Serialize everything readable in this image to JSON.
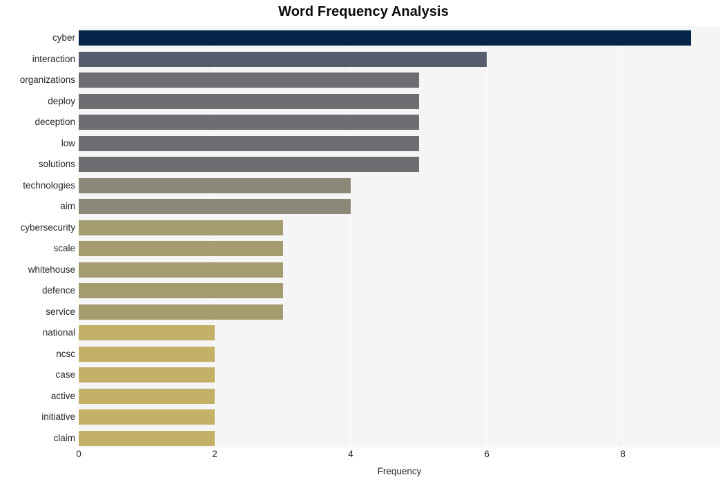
{
  "chart_data": {
    "type": "bar",
    "orientation": "horizontal",
    "title": "Word Frequency Analysis",
    "xlabel": "Frequency",
    "ylabel": "",
    "xlim": [
      0,
      9.43
    ],
    "xticks": [
      0,
      2,
      4,
      6,
      8
    ],
    "xtick_labels": [
      "0",
      "2",
      "4",
      "6",
      "8"
    ],
    "grid": "vertical-white-on-light-gray",
    "legend": "none",
    "categories": [
      "cyber",
      "interaction",
      "organizations",
      "deploy",
      "deception",
      "low",
      "solutions",
      "technologies",
      "aim",
      "cybersecurity",
      "scale",
      "whitehouse",
      "defence",
      "service",
      "national",
      "ncsc",
      "case",
      "active",
      "initiative",
      "claim"
    ],
    "values": [
      9,
      6,
      5,
      5,
      5,
      5,
      5,
      4,
      4,
      3,
      3,
      3,
      3,
      3,
      2,
      2,
      2,
      2,
      2,
      2
    ],
    "bar_colors": [
      "#042449",
      "#575c6e",
      "#6c6e72",
      "#6c6e72",
      "#6c6e72",
      "#6c6e72",
      "#6c6e72",
      "#8a8879",
      "#8a8879",
      "#a49b6f",
      "#a49b6f",
      "#a49b6f",
      "#a49b6f",
      "#a49b6f",
      "#c3b168",
      "#c3b168",
      "#c3b168",
      "#c3b168",
      "#c3b168",
      "#c3b168"
    ],
    "plot_background": "#f5f5f6",
    "figure_background": "#ffffff",
    "gridline_color": "#ffffff",
    "text_color": "#262626",
    "title_color": "#0a0a0a"
  }
}
